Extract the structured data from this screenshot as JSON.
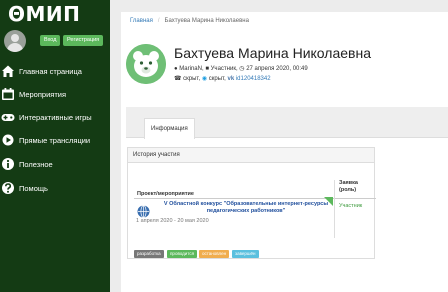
{
  "sidebar": {
    "logo": "ΘМИП",
    "login_label": "Вход",
    "register_label": "Регистрация",
    "items": [
      {
        "label": "Главная страница",
        "icon": "home-icon"
      },
      {
        "label": "Мероприятия",
        "icon": "calendar-icon"
      },
      {
        "label": "Интерактивные игры",
        "icon": "gamepad-icon"
      },
      {
        "label": "Прямые трансляции",
        "icon": "broadcast-icon"
      },
      {
        "label": "Полезное",
        "icon": "info-icon"
      },
      {
        "label": "Помощь",
        "icon": "question-icon"
      }
    ]
  },
  "breadcrumb": {
    "home": "Главная",
    "current": "Бахтуева Марина Николаевна"
  },
  "profile": {
    "name": "Бахтуева Марина Николаевна",
    "username": "MarinaN",
    "role": "Участник",
    "date": "27 апреля 2020, 00:49",
    "hidden1": "скрыт,",
    "hidden2": "скрыт,",
    "vk": "id120418342"
  },
  "tabs": [
    {
      "label": "Информация"
    }
  ],
  "history": {
    "title": "История участия",
    "col_event": "Проект/мероприятие",
    "col_request": "Заявка (роль)",
    "rows": [
      {
        "title": "V Областной конкурс \"Образовательные интернет-ресурсы педагогических работников\"",
        "dates": "1 апреля 2020 - 20 мая 2020",
        "status": "Участник"
      }
    ]
  },
  "legend": [
    "разработка",
    "проводится",
    "остановлен",
    "завершён"
  ],
  "colors": {
    "sidebar": "#143b14",
    "accent": "#5cb85c",
    "badge_dev": "#777777",
    "badge_running": "#5cb85c",
    "badge_stopped": "#f0ad4e",
    "badge_done": "#5bc0de"
  }
}
